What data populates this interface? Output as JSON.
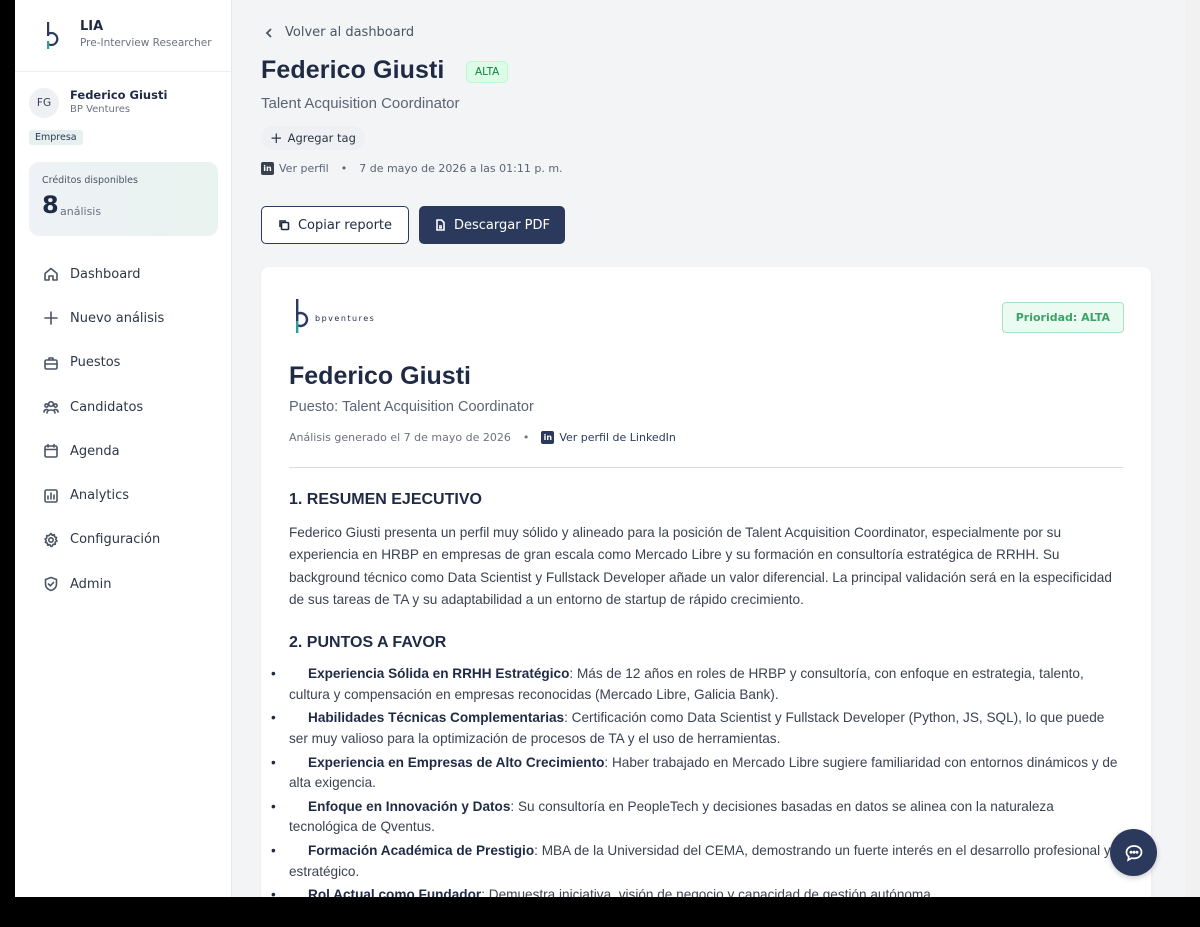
{
  "brand": {
    "name": "LIA",
    "subtitle": "Pre-Interview Researcher"
  },
  "user": {
    "initials": "FG",
    "name": "Federico Giusti",
    "company": "BP Ventures",
    "badge": "Empresa"
  },
  "credits": {
    "label": "Créditos disponibles",
    "value": "8",
    "unit": "análisis"
  },
  "nav": [
    {
      "label": "Dashboard",
      "icon": "home-icon"
    },
    {
      "label": "Nuevo análisis",
      "icon": "plus-icon"
    },
    {
      "label": "Puestos",
      "icon": "briefcase-icon"
    },
    {
      "label": "Candidatos",
      "icon": "users-icon"
    },
    {
      "label": "Agenda",
      "icon": "calendar-icon"
    },
    {
      "label": "Analytics",
      "icon": "bar-chart-icon"
    },
    {
      "label": "Configuración",
      "icon": "gear-icon"
    },
    {
      "label": "Admin",
      "icon": "shield-icon"
    }
  ],
  "header": {
    "back_label": "Volver al dashboard",
    "candidate_name": "Federico Giusti",
    "priority_badge": "ALTA",
    "role": "Talent Acquisition Coordinator",
    "add_tag_label": "Agregar tag",
    "profile_link": "Ver perfil",
    "date": "7 de mayo de 2026 a las 01:11 p. m.",
    "copy_label": "Copiar reporte",
    "pdf_label": "Descargar PDF"
  },
  "report": {
    "logo_text": "bpventures",
    "priority_label": "Prioridad: ALTA",
    "name": "Federico Giusti",
    "role": "Puesto: Talent Acquisition Coordinator",
    "generated": "Análisis generado el 7 de mayo de 2026",
    "linkedin_link": "Ver perfil de LinkedIn",
    "section1_title": "1. RESUMEN EJECUTIVO",
    "summary": "Federico Giusti presenta un perfil muy sólido y alineado para la posición de Talent Acquisition Coordinator, especialmente por su experiencia en HRBP en empresas de gran escala como Mercado Libre y su formación en consultoría estratégica de RRHH. Su background técnico como Data Scientist y Fullstack Developer añade un valor diferencial. La principal validación será en la especificidad de sus tareas de TA y su adaptabilidad a un entorno de startup de rápido crecimiento.",
    "section2_title": "2. PUNTOS A FAVOR",
    "strengths": [
      {
        "title": "Experiencia Sólida en RRHH Estratégico",
        "text": ": Más de 12 años en roles de HRBP y consultoría, con enfoque en estrategia, talento, cultura y compensación en empresas reconocidas (Mercado Libre, Galicia Bank)."
      },
      {
        "title": "Habilidades Técnicas Complementarias",
        "text": ": Certificación como Data Scientist y Fullstack Developer (Python, JS, SQL), lo que puede ser muy valioso para la optimización de procesos de TA y el uso de herramientas."
      },
      {
        "title": "Experiencia en Empresas de Alto Crecimiento",
        "text": ": Haber trabajado en Mercado Libre sugiere familiaridad con entornos dinámicos y de alta exigencia."
      },
      {
        "title": "Enfoque en Innovación y Datos",
        "text": ": Su consultoría en PeopleTech y decisiones basadas en datos se alinea con la naturaleza tecnológica de Qventus."
      },
      {
        "title": "Formación Académica de Prestigio",
        "text": ": MBA de la Universidad del CEMA, demostrando un fuerte interés en el desarrollo profesional y estratégico."
      },
      {
        "title": "Rol Actual como Fundador",
        "text": ": Demuestra iniciativa, visión de negocio y capacidad de gestión autónoma."
      }
    ]
  },
  "colors": {
    "navy": "#2b3a5c",
    "success": "#15803d",
    "accent_teal": "#2aa198"
  }
}
